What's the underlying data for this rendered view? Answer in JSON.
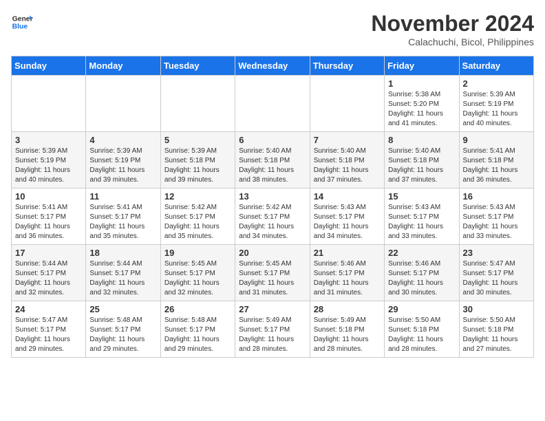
{
  "header": {
    "logo_line1": "General",
    "logo_line2": "Blue",
    "title": "November 2024",
    "location": "Calachuchi, Bicol, Philippines"
  },
  "weekdays": [
    "Sunday",
    "Monday",
    "Tuesday",
    "Wednesday",
    "Thursday",
    "Friday",
    "Saturday"
  ],
  "weeks": [
    [
      {
        "day": "",
        "info": ""
      },
      {
        "day": "",
        "info": ""
      },
      {
        "day": "",
        "info": ""
      },
      {
        "day": "",
        "info": ""
      },
      {
        "day": "",
        "info": ""
      },
      {
        "day": "1",
        "info": "Sunrise: 5:38 AM\nSunset: 5:20 PM\nDaylight: 11 hours and 41 minutes."
      },
      {
        "day": "2",
        "info": "Sunrise: 5:39 AM\nSunset: 5:19 PM\nDaylight: 11 hours and 40 minutes."
      }
    ],
    [
      {
        "day": "3",
        "info": "Sunrise: 5:39 AM\nSunset: 5:19 PM\nDaylight: 11 hours and 40 minutes."
      },
      {
        "day": "4",
        "info": "Sunrise: 5:39 AM\nSunset: 5:19 PM\nDaylight: 11 hours and 39 minutes."
      },
      {
        "day": "5",
        "info": "Sunrise: 5:39 AM\nSunset: 5:18 PM\nDaylight: 11 hours and 39 minutes."
      },
      {
        "day": "6",
        "info": "Sunrise: 5:40 AM\nSunset: 5:18 PM\nDaylight: 11 hours and 38 minutes."
      },
      {
        "day": "7",
        "info": "Sunrise: 5:40 AM\nSunset: 5:18 PM\nDaylight: 11 hours and 37 minutes."
      },
      {
        "day": "8",
        "info": "Sunrise: 5:40 AM\nSunset: 5:18 PM\nDaylight: 11 hours and 37 minutes."
      },
      {
        "day": "9",
        "info": "Sunrise: 5:41 AM\nSunset: 5:18 PM\nDaylight: 11 hours and 36 minutes."
      }
    ],
    [
      {
        "day": "10",
        "info": "Sunrise: 5:41 AM\nSunset: 5:17 PM\nDaylight: 11 hours and 36 minutes."
      },
      {
        "day": "11",
        "info": "Sunrise: 5:41 AM\nSunset: 5:17 PM\nDaylight: 11 hours and 35 minutes."
      },
      {
        "day": "12",
        "info": "Sunrise: 5:42 AM\nSunset: 5:17 PM\nDaylight: 11 hours and 35 minutes."
      },
      {
        "day": "13",
        "info": "Sunrise: 5:42 AM\nSunset: 5:17 PM\nDaylight: 11 hours and 34 minutes."
      },
      {
        "day": "14",
        "info": "Sunrise: 5:43 AM\nSunset: 5:17 PM\nDaylight: 11 hours and 34 minutes."
      },
      {
        "day": "15",
        "info": "Sunrise: 5:43 AM\nSunset: 5:17 PM\nDaylight: 11 hours and 33 minutes."
      },
      {
        "day": "16",
        "info": "Sunrise: 5:43 AM\nSunset: 5:17 PM\nDaylight: 11 hours and 33 minutes."
      }
    ],
    [
      {
        "day": "17",
        "info": "Sunrise: 5:44 AM\nSunset: 5:17 PM\nDaylight: 11 hours and 32 minutes."
      },
      {
        "day": "18",
        "info": "Sunrise: 5:44 AM\nSunset: 5:17 PM\nDaylight: 11 hours and 32 minutes."
      },
      {
        "day": "19",
        "info": "Sunrise: 5:45 AM\nSunset: 5:17 PM\nDaylight: 11 hours and 32 minutes."
      },
      {
        "day": "20",
        "info": "Sunrise: 5:45 AM\nSunset: 5:17 PM\nDaylight: 11 hours and 31 minutes."
      },
      {
        "day": "21",
        "info": "Sunrise: 5:46 AM\nSunset: 5:17 PM\nDaylight: 11 hours and 31 minutes."
      },
      {
        "day": "22",
        "info": "Sunrise: 5:46 AM\nSunset: 5:17 PM\nDaylight: 11 hours and 30 minutes."
      },
      {
        "day": "23",
        "info": "Sunrise: 5:47 AM\nSunset: 5:17 PM\nDaylight: 11 hours and 30 minutes."
      }
    ],
    [
      {
        "day": "24",
        "info": "Sunrise: 5:47 AM\nSunset: 5:17 PM\nDaylight: 11 hours and 29 minutes."
      },
      {
        "day": "25",
        "info": "Sunrise: 5:48 AM\nSunset: 5:17 PM\nDaylight: 11 hours and 29 minutes."
      },
      {
        "day": "26",
        "info": "Sunrise: 5:48 AM\nSunset: 5:17 PM\nDaylight: 11 hours and 29 minutes."
      },
      {
        "day": "27",
        "info": "Sunrise: 5:49 AM\nSunset: 5:17 PM\nDaylight: 11 hours and 28 minutes."
      },
      {
        "day": "28",
        "info": "Sunrise: 5:49 AM\nSunset: 5:18 PM\nDaylight: 11 hours and 28 minutes."
      },
      {
        "day": "29",
        "info": "Sunrise: 5:50 AM\nSunset: 5:18 PM\nDaylight: 11 hours and 28 minutes."
      },
      {
        "day": "30",
        "info": "Sunrise: 5:50 AM\nSunset: 5:18 PM\nDaylight: 11 hours and 27 minutes."
      }
    ]
  ]
}
